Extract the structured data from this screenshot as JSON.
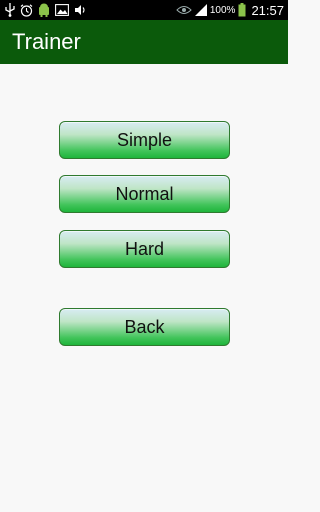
{
  "status_bar": {
    "icons": [
      "usb-icon",
      "alarm-icon",
      "android-icon",
      "image-icon",
      "volume-icon",
      "eye-icon",
      "signal-icon",
      "battery-icon"
    ],
    "battery_percent": "100%",
    "time": "21:57"
  },
  "app_bar": {
    "title": "Trainer"
  },
  "menu": {
    "simple_label": "Simple",
    "normal_label": "Normal",
    "hard_label": "Hard",
    "back_label": "Back"
  },
  "colors": {
    "app_bar": "#0b5a0b",
    "background": "#f8f8f8",
    "button_green": "#1fb53c"
  }
}
